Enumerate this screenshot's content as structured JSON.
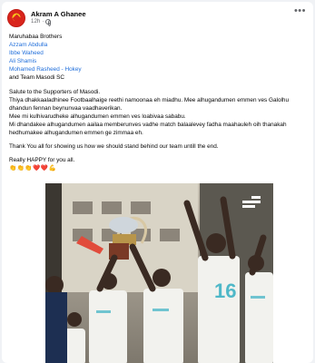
{
  "post": {
    "author": "Akram A Ghanee",
    "time": "12h",
    "separator": "·",
    "more_label": "•••",
    "greeting": "Maruhabaa Brothers",
    "tags": [
      "Azzam Abdulla",
      "Ibbe Waheed",
      "Ali Shamis",
      "Mohamed Rasheed - Hokey"
    ],
    "team_line": "and Team Masodi SC",
    "paragraph1": [
      "Salute to the Supporters of Masodi.",
      "Thiya dhakkaaladhinee Footbaalhaige reethi namoonaa eh miadhu. Mee alhugandumen emmen ves Galolhu dhandun fennan beynunvaa vaadhaverikan.",
      "Mee mi kulhivarudheke alhugandumen emmen ves loabivaa sababu.",
      "Mi dhandakee alhugandumen aailaa memberunves vadhe match balaalevey fadha maahauleh oih thanakah hedhumakee alhugandumen emmen ge zimmaa eh."
    ],
    "thanks": "Thank You all for showing us how we should stand behind our team untill the end.",
    "happy": "Really HAPPY for you all.",
    "emojis": "👏👏👏❤️❤️💪"
  },
  "photo": {
    "icon": "photo-watermark-icon"
  },
  "colors": {
    "link": "#216fdb",
    "muted": "#65676b",
    "text": "#050505",
    "avatar_red": "#d9251c",
    "avatar_gold": "#f6c21b"
  }
}
